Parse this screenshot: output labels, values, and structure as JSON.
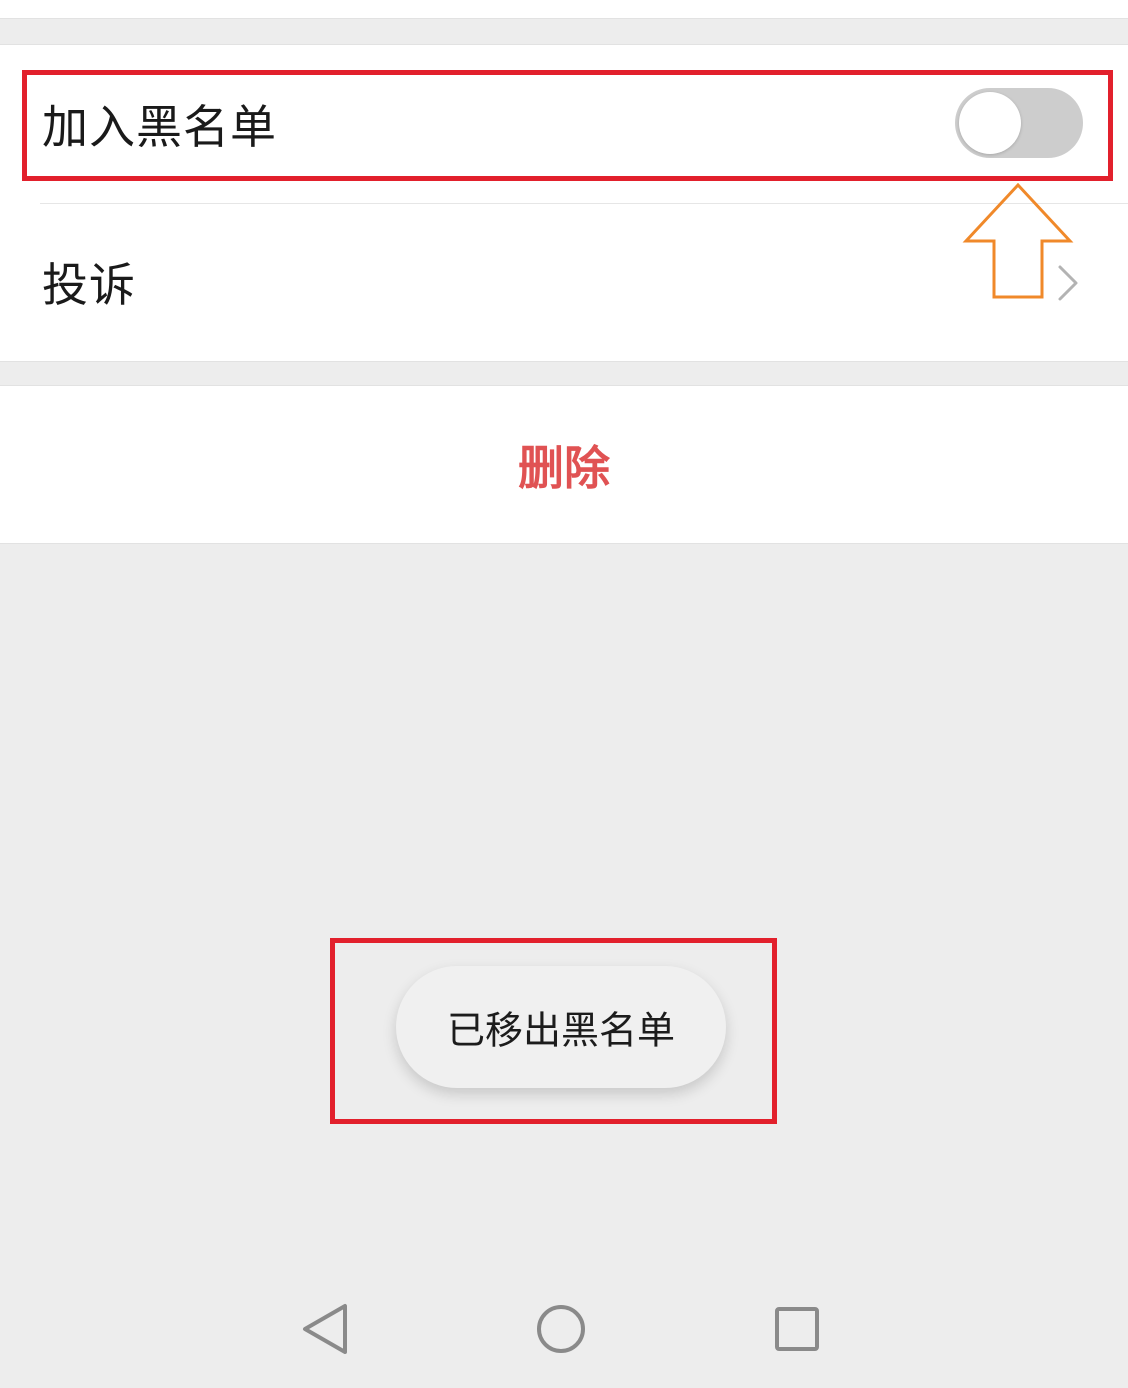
{
  "settings": {
    "blacklist": {
      "label": "加入黑名单",
      "toggle_on": false
    },
    "complaint": {
      "label": "投诉"
    }
  },
  "actions": {
    "delete_label": "删除",
    "delete_color": "#e05253"
  },
  "toast": {
    "message": "已移出黑名单"
  },
  "annotations": {
    "highlight_color": "#e2202c",
    "arrow_color": "#f0892a"
  },
  "navbar": {
    "icons": [
      "back-triangle-icon",
      "home-circle-icon",
      "recent-square-icon"
    ]
  }
}
